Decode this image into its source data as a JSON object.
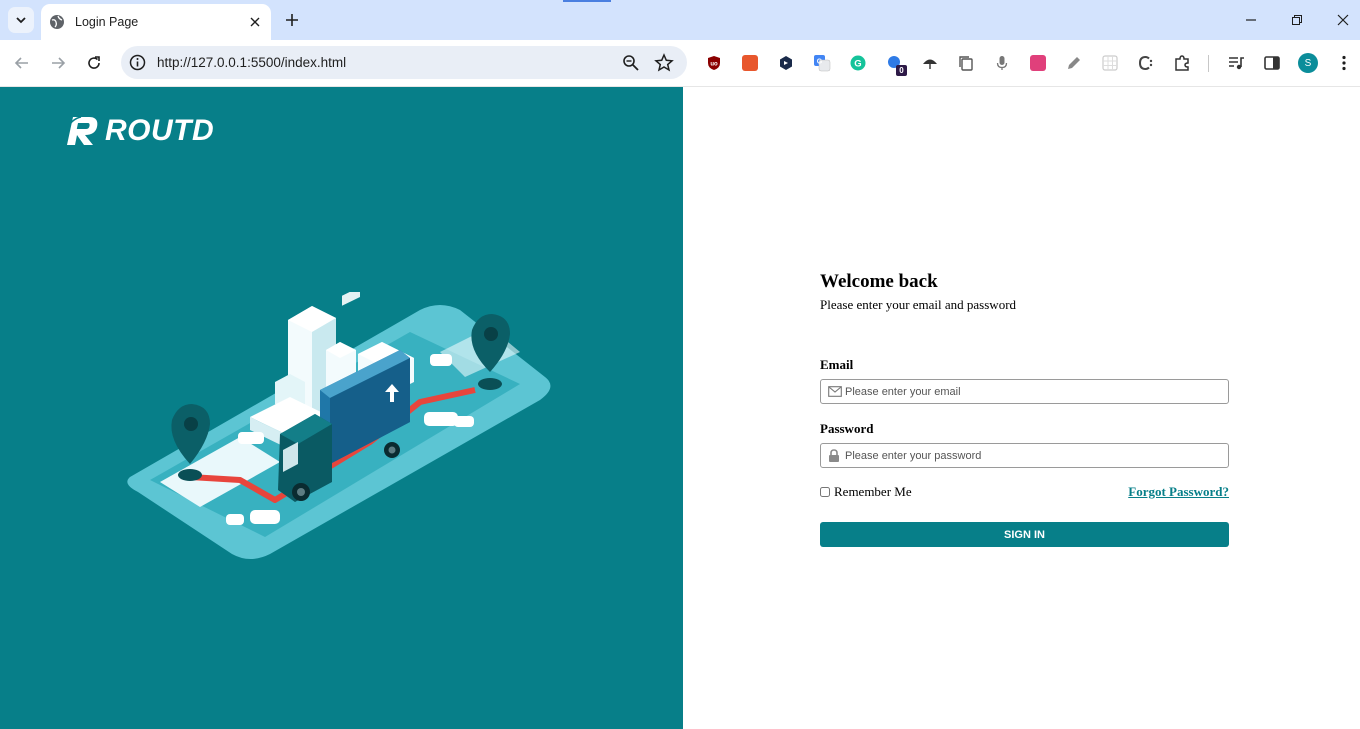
{
  "browser": {
    "tab_title": "Login Page",
    "url": "http://127.0.0.1:5500/index.html",
    "extensions": [
      {
        "name": "ublock-icon",
        "color": "#8b0000"
      },
      {
        "name": "rocket-extension-icon",
        "color": "#e8572d"
      },
      {
        "name": "dark-hex-extension-icon",
        "color": "#1a2a4a"
      },
      {
        "name": "google-translate-icon",
        "color": "#4285f4"
      },
      {
        "name": "grammarly-icon",
        "color": "#15c39a"
      },
      {
        "name": "badge-extension-icon",
        "color": "#2f7be6",
        "badge": "0"
      },
      {
        "name": "umbrella-extension-icon",
        "color": "#333333"
      },
      {
        "name": "copy-extension-icon",
        "color": "#555555"
      },
      {
        "name": "microphone-icon",
        "color": "#777777"
      },
      {
        "name": "pink-extension-icon",
        "color": "#e0407b"
      },
      {
        "name": "pencil-icon",
        "color": "#777777"
      },
      {
        "name": "grid-extension-icon",
        "color": "#cccccc"
      },
      {
        "name": "c-extension-icon",
        "color": "#444444"
      },
      {
        "name": "puzzle-icon",
        "color": "#333333"
      }
    ],
    "profile_initial": "S"
  },
  "brand": {
    "name": "ROUTD",
    "primary_color": "#077f89"
  },
  "login": {
    "heading": "Welcome back",
    "subtitle": "Please enter your email and password",
    "email_label": "Email",
    "email_placeholder": "Please enter your email",
    "password_label": "Password",
    "password_placeholder": "Please enter your password",
    "remember_label": "Remember Me",
    "forgot_label": "Forgot Password?",
    "signin_label": "SIGN IN"
  }
}
